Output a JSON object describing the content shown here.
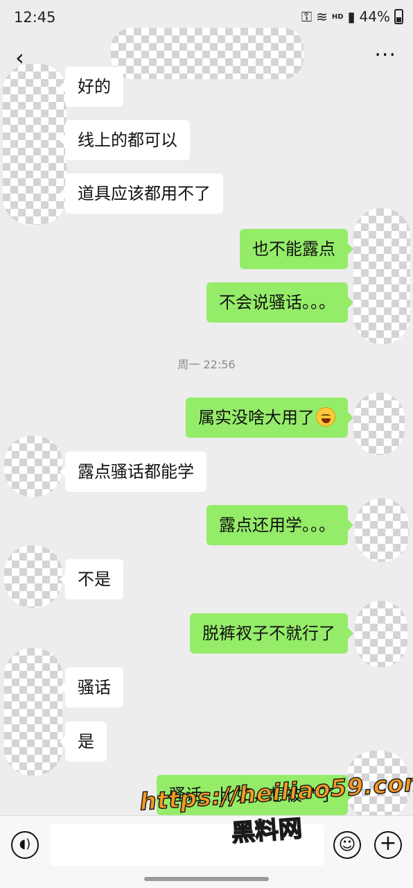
{
  "status_bar": {
    "time": "12:45",
    "network": "HD",
    "battery": "44%"
  },
  "navbar": {
    "back": "‹",
    "more": "···"
  },
  "timestamp": "周一 22:56",
  "messages": [
    {
      "side": "in",
      "text": "好的"
    },
    {
      "side": "in",
      "text": "线上的都可以"
    },
    {
      "side": "in",
      "text": "道具应该都用不了"
    },
    {
      "side": "out",
      "text": "也不能露点"
    },
    {
      "side": "out",
      "text": "不会说骚话。。。"
    },
    {
      "side": "out",
      "text": "属实没啥大用了",
      "emoji": "rolling-on-floor-laughing"
    },
    {
      "side": "in",
      "text": "露点骚话都能学"
    },
    {
      "side": "out",
      "text": "露点还用学。。。"
    },
    {
      "side": "in",
      "text": "不是"
    },
    {
      "side": "out",
      "text": "脱裤衩子不就行了"
    },
    {
      "side": "in",
      "text": "骚话"
    },
    {
      "side": "in",
      "text": "是"
    },
    {
      "side": "out",
      "text": "骚话，比如，想被艹了"
    }
  ],
  "watermark": {
    "url": "https://heiliao59.com",
    "name": "黑料网"
  },
  "colors": {
    "background": "#ededed",
    "outgoing_bubble": "#95ec69",
    "incoming_bubble": "#ffffff",
    "watermark": "#f59a23"
  }
}
